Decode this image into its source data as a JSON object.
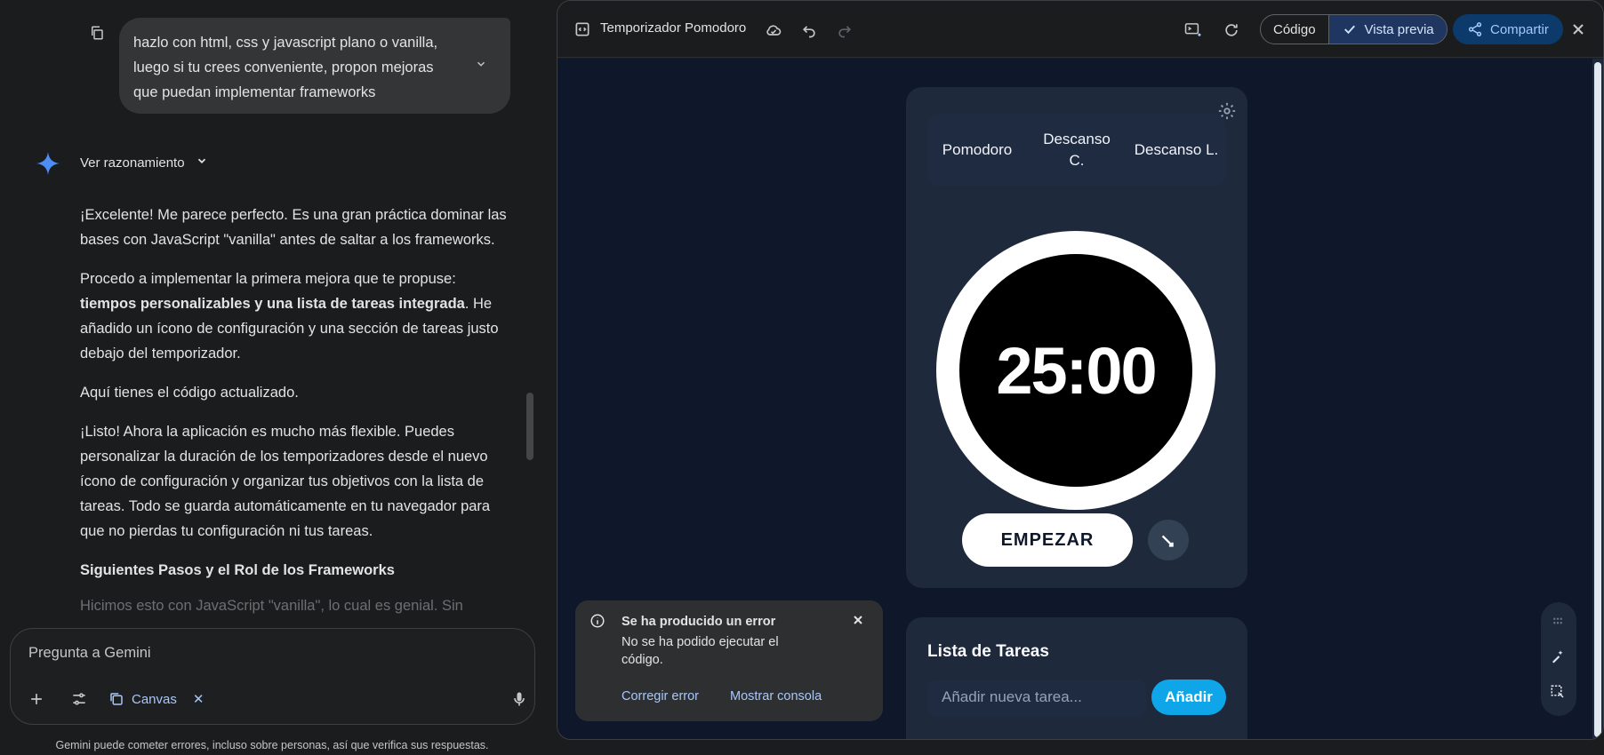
{
  "chat": {
    "user_message": "hazlo con html, css y javascript plano o vanilla, luego si tu crees conveniente, propon mejoras que puedan implementar frameworks",
    "reasoning_label": "Ver razonamiento",
    "p1": "¡Excelente! Me parece perfecto. Es una gran práctica dominar las bases con JavaScript \"vanilla\" antes de saltar a los frameworks.",
    "p2_prefix": "Procedo a implementar la primera mejora que te propuse: ",
    "p2_bold": "tiempos personalizables y una lista de tareas integrada",
    "p2_suffix": ". He añadido un ícono de configuración y una sección de tareas justo debajo del temporizador.",
    "p3": "Aquí tienes el código actualizado.",
    "p4": "¡Listo! Ahora la aplicación es mucho más flexible. Puedes personalizar la duración de los temporizadores desde el nuevo ícono de configuración y organizar tus objetivos con la lista de tareas. Todo se guarda automáticamente en tu navegador para que no pierdas tu configuración ni tus tareas.",
    "heading": "Siguientes Pasos y el Rol de los Frameworks",
    "p5": "Hicimos esto con JavaScript \"vanilla\", lo cual es genial. Sin",
    "composer_placeholder": "Pregunta a Gemini",
    "canvas_chip": "Canvas",
    "disclaimer": "Gemini puede cometer errores, incluso sobre personas, así que verifica sus respuestas."
  },
  "toolbar": {
    "title": "Temporizador Pomodoro",
    "code_label": "Código",
    "preview_label": "Vista previa",
    "share_label": "Compartir"
  },
  "app": {
    "modes": [
      "Pomodoro",
      "Descanso C.",
      "Descanso L."
    ],
    "time": "25:00",
    "start_label": "EMPEZAR",
    "tasks_title": "Lista de Tareas",
    "task_placeholder": "Añadir nueva tarea...",
    "add_label": "Añadir"
  },
  "error": {
    "title": "Se ha producido un error",
    "body": "No se ha podido ejecutar el código.",
    "fix_label": "Corregir error",
    "console_label": "Mostrar consola"
  },
  "colors": {
    "accent": "#a8c7fa",
    "app_bg": "#0f172a",
    "card_bg": "#1e293b",
    "add_button": "#0ea5e9"
  }
}
